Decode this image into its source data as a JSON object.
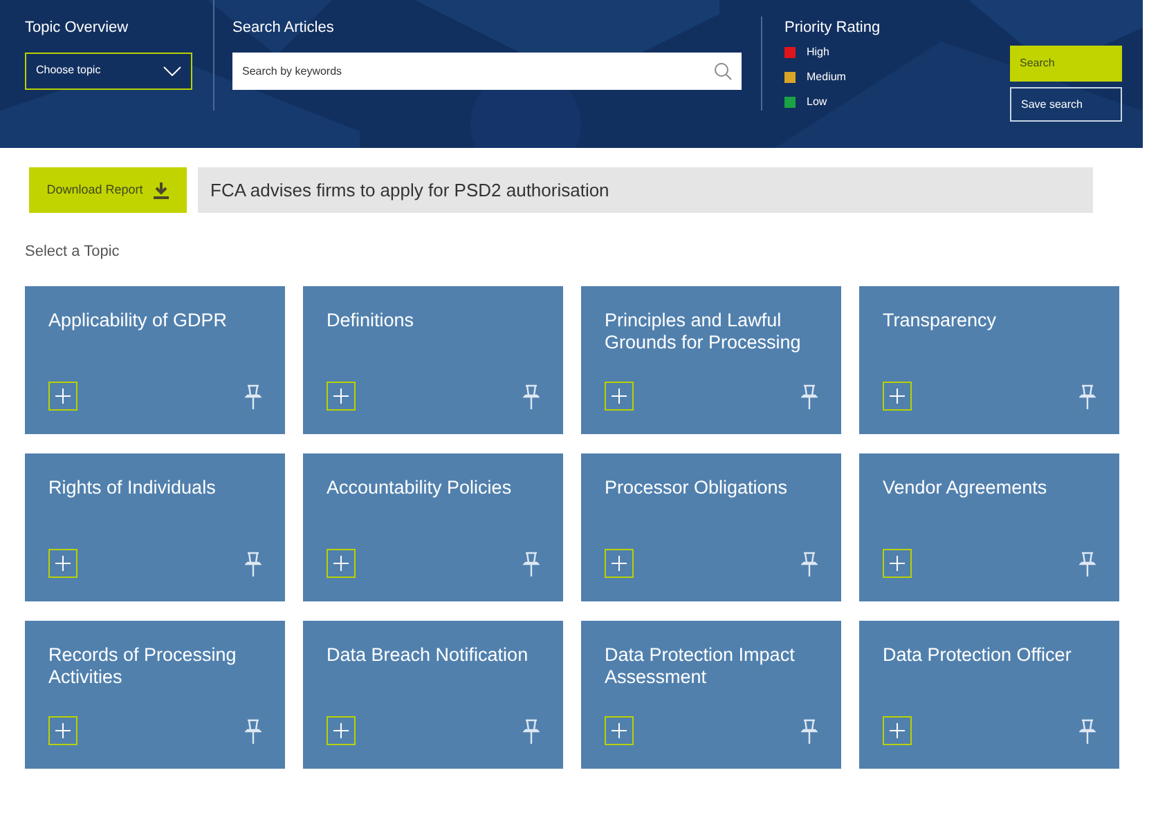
{
  "header": {
    "topic_overview": {
      "label": "Topic Overview",
      "dropdown": "Choose topic"
    },
    "search_articles": {
      "label": "Search Articles",
      "placeholder": "Search by keywords"
    },
    "priority_rating": {
      "label": "Priority Rating",
      "levels": [
        {
          "name": "High",
          "color": "#e0141b"
        },
        {
          "name": "Medium",
          "color": "#d9a526"
        },
        {
          "name": "Low",
          "color": "#1aa345"
        }
      ]
    },
    "buttons": [
      {
        "label": "Search",
        "kind": "primary"
      },
      {
        "label": "Save search",
        "kind": "outline"
      }
    ]
  },
  "download_button": "Download Report",
  "headline": "FCA advises firms to apply for PSD2 authorisation",
  "section_title": "Select a Topic",
  "topics": [
    {
      "title": "Applicability of GDPR"
    },
    {
      "title": "Definitions"
    },
    {
      "title": "Principles and Lawful Grounds for Processing"
    },
    {
      "title": "Transparency"
    },
    {
      "title": "Rights of Individuals"
    },
    {
      "title": "Accountability Policies"
    },
    {
      "title": "Processor Obligations"
    },
    {
      "title": "Vendor Agreements"
    },
    {
      "title": "Records of Processing Activities"
    },
    {
      "title": "Data Breach Notification"
    },
    {
      "title": "Data Protection Impact Assessment"
    },
    {
      "title": "Data Protection Officer"
    }
  ]
}
